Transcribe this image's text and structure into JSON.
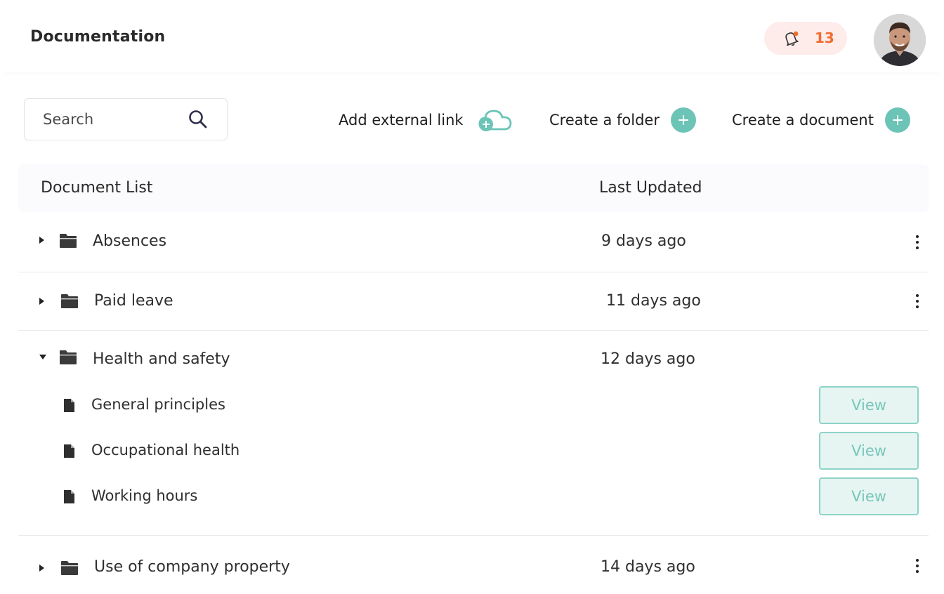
{
  "header": {
    "title": "Documentation",
    "notification_count": "13",
    "accent": "#f26d2f"
  },
  "toolbar": {
    "search_placeholder": "Search",
    "add_external_link": "Add external link",
    "create_folder": "Create a folder",
    "create_document": "Create a document",
    "accent": "#6cc4b6"
  },
  "list": {
    "col_document": "Document List",
    "col_updated": "Last Updated",
    "folders": [
      {
        "name": "Absences",
        "updated": "9 days ago",
        "expanded": false
      },
      {
        "name": "Paid leave",
        "updated": "11 days ago",
        "expanded": false
      },
      {
        "name": "Health and safety",
        "updated": "12 days ago",
        "expanded": true,
        "documents": [
          {
            "name": "General principles",
            "action": "View"
          },
          {
            "name": "Occupational health",
            "action": "View"
          },
          {
            "name": "Working hours",
            "action": "View"
          }
        ]
      },
      {
        "name": "Use of company property",
        "updated": "14 days ago",
        "expanded": false
      }
    ]
  }
}
